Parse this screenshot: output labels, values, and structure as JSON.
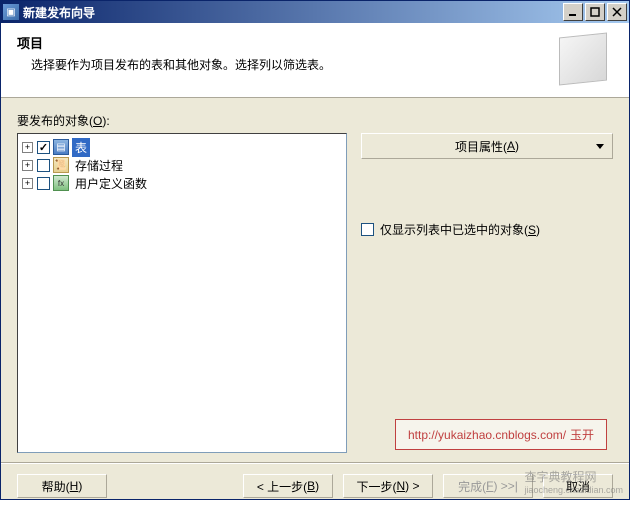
{
  "titlebar": {
    "text": "新建发布向导"
  },
  "header": {
    "title": "项目",
    "description": "选择要作为项目发布的表和其他对象。选择列以筛选表。"
  },
  "section": {
    "label_pre": "要发布的对象(",
    "label_key": "O",
    "label_post": "):"
  },
  "tree": {
    "items": [
      {
        "expander": "+",
        "checked": true,
        "icon": "table",
        "label": "表",
        "selected": true
      },
      {
        "expander": "+",
        "checked": false,
        "icon": "proc",
        "label": "存储过程",
        "selected": false
      },
      {
        "expander": "+",
        "checked": false,
        "icon": "func",
        "label": "用户定义函数",
        "selected": false
      }
    ]
  },
  "right": {
    "props_button_pre": "项目属性(",
    "props_button_key": "A",
    "props_button_post": ")",
    "filter_label_pre": "仅显示列表中已选中的对象(",
    "filter_label_key": "S",
    "filter_label_post": ")"
  },
  "watermark": {
    "url": "http://yukaizhao.cnblogs.com/",
    "name": "玉开"
  },
  "buttons": {
    "help_pre": "帮助(",
    "help_key": "H",
    "help_post": ")",
    "back_pre": "< 上一步(",
    "back_key": "B",
    "back_post": ")",
    "next_pre": "下一步(",
    "next_key": "N",
    "next_post": ") >",
    "finish_pre": "完成(",
    "finish_key": "F",
    "finish_post": ") >>|",
    "cancel": "取消"
  },
  "bg_watermark": "查字典教程网\njiaocheng.chazidian.com"
}
